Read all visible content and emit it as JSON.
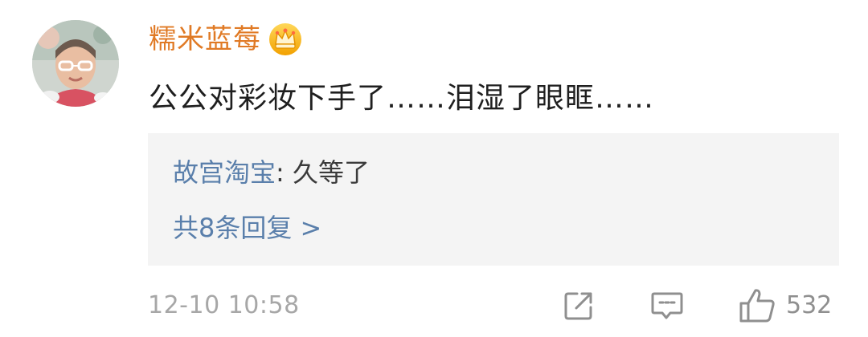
{
  "comment": {
    "username": "糯米蓝莓",
    "text": "公公对彩妆下手了……泪湿了眼眶……",
    "reply": {
      "author": "故宫淘宝",
      "separator": ": ",
      "text": "久等了",
      "more_label": "共8条回复 >"
    },
    "timestamp": "12-10 10:58",
    "like_count": "532"
  },
  "colors": {
    "username": "#e07a25",
    "link": "#5a7fab",
    "text": "#1f1f1f",
    "meta": "#a7a7a7",
    "reply_bg": "#f4f4f4"
  },
  "icons": {
    "badge": "crown-badge-icon",
    "share": "share-icon",
    "comment": "comment-icon",
    "like": "thumbs-up-icon"
  }
}
